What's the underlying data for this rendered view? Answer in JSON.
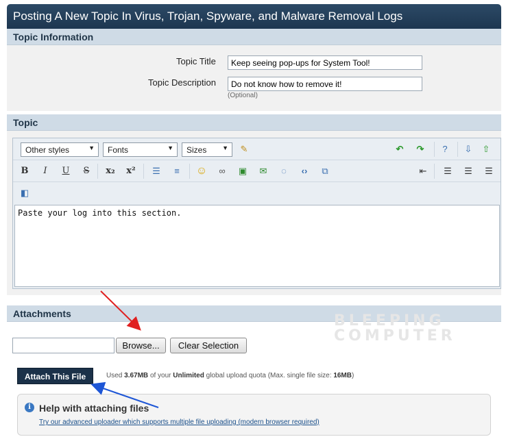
{
  "page_title": "Posting A New Topic In Virus, Trojan, Spyware, and Malware Removal Logs",
  "topic_info": {
    "heading": "Topic Information",
    "title_label": "Topic Title",
    "title_value": "Keep seeing pop-ups for System Tool!",
    "description_label": "Topic Description",
    "description_value": "Do not know how to remove it!",
    "description_hint": "(Optional)"
  },
  "topic": {
    "heading": "Topic",
    "styles_select": "Other styles",
    "fonts_select": "Fonts",
    "sizes_select": "Sizes",
    "body_text": "Paste your log into this section."
  },
  "attachments": {
    "heading": "Attachments",
    "browse_label": "Browse...",
    "clear_label": "Clear Selection",
    "attach_label": "Attach This File",
    "quota_prefix": "Used",
    "quota_used": "3.67MB",
    "quota_mid": "of your",
    "quota_limit": "Unlimited",
    "quota_suffix": "global upload quota (Max. single file size:",
    "quota_max": "16MB",
    "quota_end": ")",
    "help_title": "Help with attaching files",
    "help_link": "Try our advanced uploader which supports multiple file uploading (modern browser required)"
  },
  "watermark": {
    "line1": "BLEEPING",
    "line2": "COMPUTER"
  },
  "colors": {
    "title_bar": "#1d3650",
    "section_head": "#cfdbe6",
    "annotation_red": "#e02020",
    "annotation_blue": "#1e56d6"
  }
}
